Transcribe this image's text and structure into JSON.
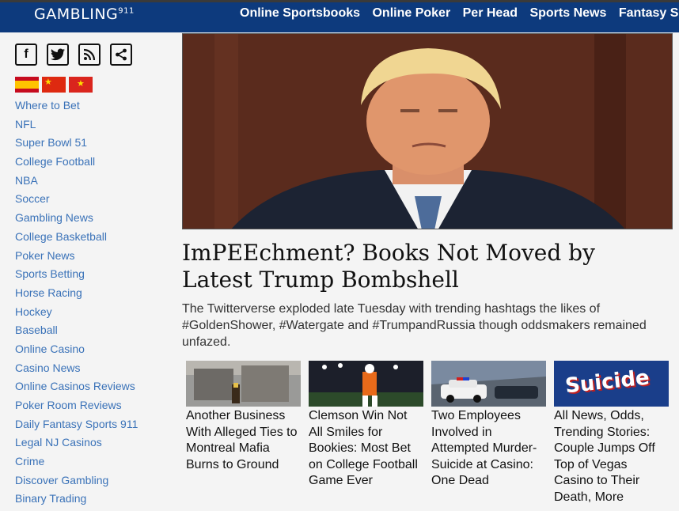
{
  "header": {
    "logo": "GAMBLING",
    "logo_suffix": "911",
    "nav": [
      "Online Sportsbooks",
      "Online Poker",
      "Per Head",
      "Sports News",
      "Fantasy Spor"
    ]
  },
  "social": [
    {
      "icon": "facebook-icon",
      "glyph": "f"
    },
    {
      "icon": "twitter-icon",
      "glyph": "t"
    },
    {
      "icon": "rss-icon",
      "glyph": "◔"
    },
    {
      "icon": "share-icon",
      "glyph": "<"
    }
  ],
  "flags": [
    "spain-flag-icon",
    "china-flag-icon",
    "vietnam-flag-icon"
  ],
  "colors": {
    "nav_bg": "#0d3a7d",
    "link": "#3a72b8"
  },
  "sidebar": [
    "Where to Bet",
    "NFL",
    "Super Bowl 51",
    "College Football",
    "NBA",
    "Soccer",
    "Gambling News",
    "College Basketball",
    "Poker News",
    "Sports Betting",
    "Horse Racing",
    "Hockey",
    "Baseball",
    "Online Casino",
    "Casino News",
    "Online Casinos Reviews",
    "Poker Room Reviews",
    "Daily Fantasy Sports 911",
    "Legal NJ Casinos",
    "Crime",
    "Discover Gambling",
    "Binary Trading"
  ],
  "article": {
    "title": "ImPEEchment? Books Not Moved by Latest Trump Bombshell",
    "summary": "The Twitterverse exploded late Tuesday with trending hashtags the likes of #GoldenShower, #Watergate and #TrumpandRussia though oddsmakers remained unfazed."
  },
  "cards": [
    {
      "title": "Another Business With Alleged Ties to Montreal Mafia Burns to Ground"
    },
    {
      "title": "Clemson Win Not All Smiles for Bookies: Most Bet on College Football Game Ever"
    },
    {
      "title": "Two Employees Involved in Attempted Murder-Suicide at Casino: One Dead"
    },
    {
      "title": "All News, Odds, Trending Stories: Couple Jumps Off Top of Vegas Casino to Their Death, More",
      "thumb_text": "Suicide"
    }
  ]
}
